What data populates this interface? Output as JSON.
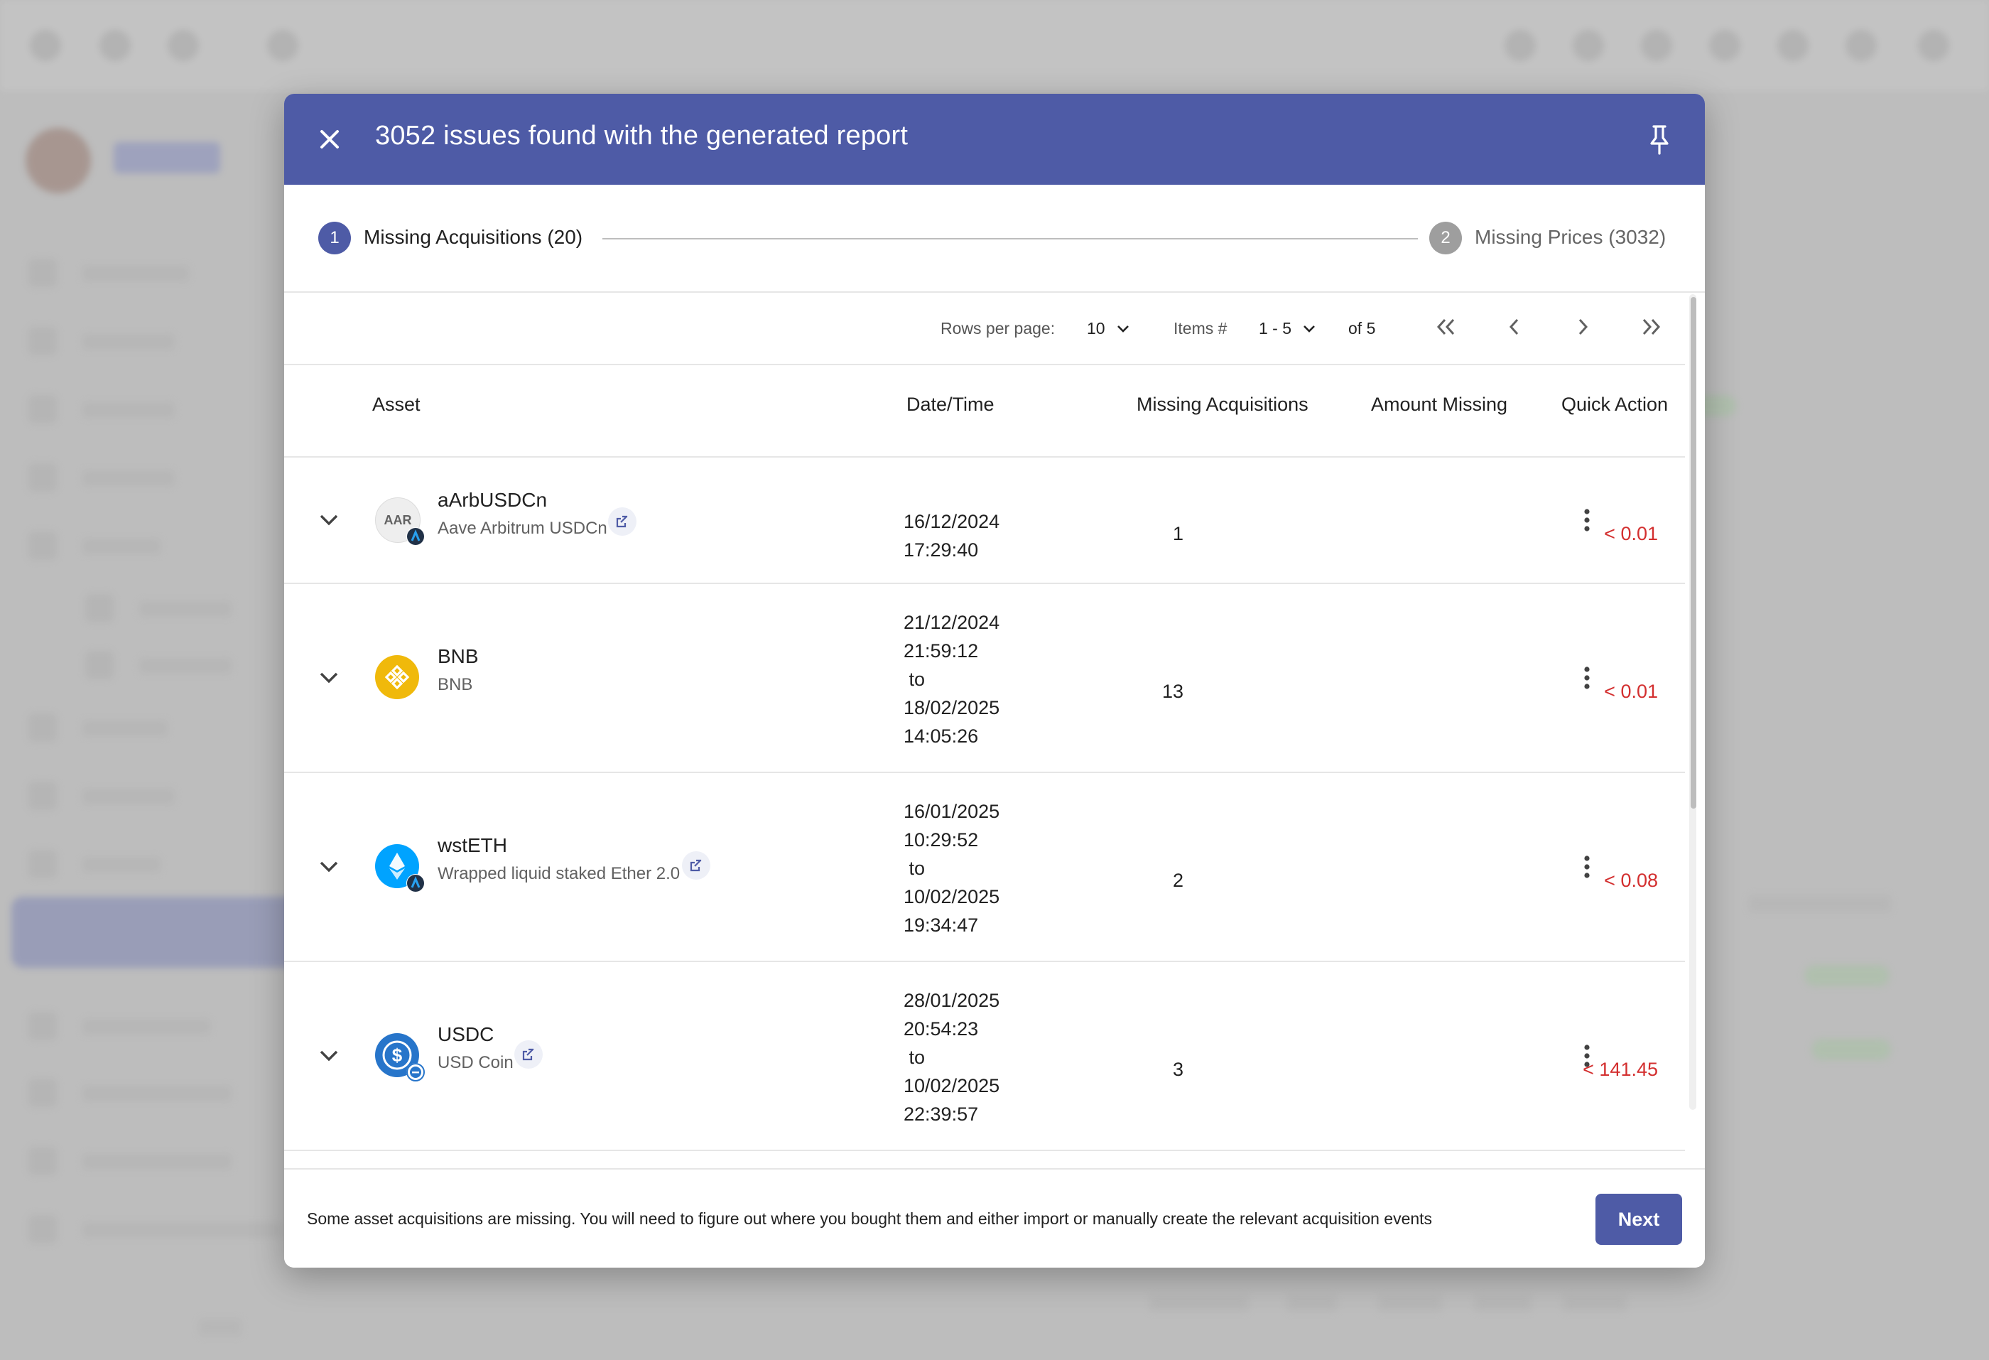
{
  "dialog": {
    "title": "3052 issues found with the generated report"
  },
  "stepper": {
    "steps": [
      {
        "number": "1",
        "label": "Missing Acquisitions (20)"
      },
      {
        "number": "2",
        "label": "Missing Prices (3032)"
      }
    ]
  },
  "pagination": {
    "rows_per_page_label": "Rows per page:",
    "rows_per_page": "10",
    "items_label": "Items #",
    "items_range": "1 - 5",
    "of_total": "of 5"
  },
  "table": {
    "columns": [
      "Asset",
      "Date/Time",
      "Missing Acquisitions",
      "Amount Missing",
      "Quick Action"
    ],
    "rows": [
      {
        "symbol": "aArbUSDCn",
        "name": "Aave Arbitrum USDCn",
        "icon_text": "AAR",
        "datetime": "16/12/2024\n17:29:40",
        "missing": "1",
        "amount": "< 0.01"
      },
      {
        "symbol": "BNB",
        "name": "BNB",
        "icon_text": "",
        "datetime": "21/12/2024\n21:59:12\n to\n18/02/2025\n14:05:26",
        "missing": "13",
        "amount": "< 0.01"
      },
      {
        "symbol": "wstETH",
        "name": "Wrapped liquid staked Ether 2.0",
        "icon_text": "",
        "datetime": "16/01/2025\n10:29:52\n to\n10/02/2025\n19:34:47",
        "missing": "2",
        "amount": "< 0.08"
      },
      {
        "symbol": "USDC",
        "name": "USD Coin",
        "icon_text": "",
        "datetime": "28/01/2025\n20:54:23\n to\n10/02/2025\n22:39:57",
        "missing": "3",
        "amount": "< 141.45"
      }
    ]
  },
  "footer": {
    "message": "Some asset acquisitions are missing. You will need to figure out where you bought them and either import or manually create the relevant acquisition events",
    "next_label": "Next"
  },
  "colors": {
    "primary": "#4e5ba6",
    "negative": "#d32f2f",
    "bnb": "#f0b90b",
    "usdc": "#2775ca",
    "wsteth": "#00a3ff"
  }
}
